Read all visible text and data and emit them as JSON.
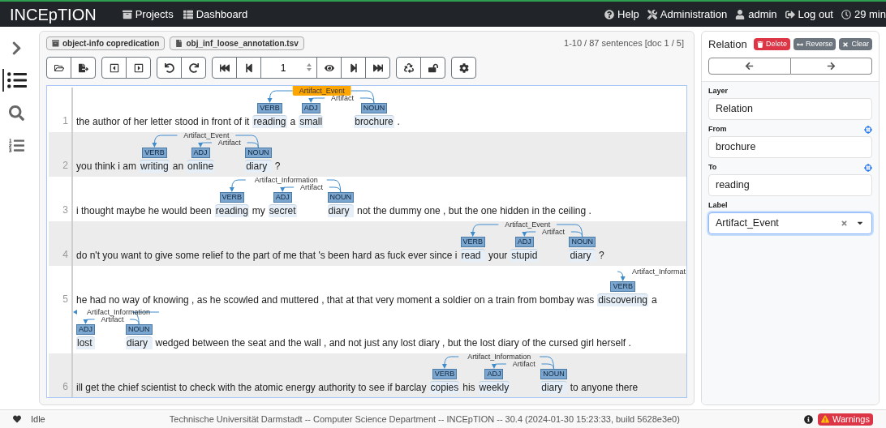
{
  "navbar": {
    "brand": "INCEpTION",
    "left": [
      "Projects",
      "Dashboard"
    ],
    "right": [
      "Help",
      "Administration",
      "admin",
      "Log out",
      "29 min"
    ]
  },
  "sidebar": [
    {
      "selected": false
    },
    {
      "selected": true
    },
    {
      "selected": false
    },
    {
      "selected": false
    }
  ],
  "breadcrumbs": [
    "object-info copredication",
    "obj_inf_loose_annotation.tsv"
  ],
  "sentence_info": "1-10 / 87 sentences [doc 1 / 5]",
  "page_field": {
    "value": "1"
  },
  "sentences": [
    {
      "number": "1",
      "lines": [
        [
          {
            "text": "the author of her letter stood in front of it"
          },
          {
            "text": "reading",
            "tag": "VERB",
            "incoming": {
              "label": "Artifact_Event",
              "selected": true
            }
          },
          {
            "text": "a"
          },
          {
            "text": "small",
            "tag": "ADJ",
            "incoming": {
              "label": "Artifact",
              "selected": false
            }
          },
          {
            "text": "brochure",
            "tag": "NOUN"
          },
          {
            "text": "."
          }
        ]
      ]
    },
    {
      "number": "2",
      "lines": [
        [
          {
            "text": "you think i am"
          },
          {
            "text": "writing",
            "tag": "VERB",
            "incoming": {
              "label": "Artifact_Event",
              "selected": false
            }
          },
          {
            "text": "an"
          },
          {
            "text": "online",
            "tag": "ADJ",
            "incoming": {
              "label": "Artifact",
              "selected": false
            }
          },
          {
            "text": "diary",
            "tag": "NOUN"
          },
          {
            "text": "?"
          }
        ]
      ]
    },
    {
      "number": "3",
      "lines": [
        [
          {
            "text": "i thought maybe he would been"
          },
          {
            "text": "reading",
            "tag": "VERB",
            "incoming": {
              "label": "Artifact_Information",
              "selected": false
            }
          },
          {
            "text": "my"
          },
          {
            "text": "secret",
            "tag": "ADJ",
            "incoming": {
              "label": "Artifact",
              "selected": false
            }
          },
          {
            "text": "diary",
            "tag": "NOUN"
          },
          {
            "text": "not the dummy one , but the one hidden in the ceiling ."
          }
        ]
      ]
    },
    {
      "number": "4",
      "lines": [
        [
          {
            "text": "do n't you want to give some relief to the part of me that 's been hard as fuck ever since i"
          },
          {
            "text": "read",
            "tag": "VERB",
            "incoming": {
              "label": "Artifact_Event",
              "selected": false
            }
          },
          {
            "text": "your"
          },
          {
            "text": "stupid",
            "tag": "ADJ",
            "incoming": {
              "label": "Artifact",
              "selected": false
            }
          },
          {
            "text": "diary",
            "tag": "NOUN"
          },
          {
            "text": "?"
          }
        ]
      ]
    },
    {
      "number": "5",
      "lines": [
        [
          {
            "text": "he had no way of knowing , as he scowled and muttered , that at that very moment a soldier on a train from bombay was"
          },
          {
            "text": "discovering",
            "tag": "VERB",
            "incoming": {
              "label": "Artifact_Information",
              "continued_label": "Artifact_Informat",
              "selected": false
            }
          },
          {
            "text": "a"
          }
        ],
        [
          {
            "text": "lost",
            "tag": "ADJ",
            "incoming": {
              "label": "Artifact",
              "selected": false
            }
          },
          {
            "text": "diary",
            "tag": "NOUN"
          },
          {
            "text": "wedged between the seat and the wall , and not just any lost diary , but the lost diary of the cursed girl herself ."
          }
        ]
      ]
    },
    {
      "number": "6",
      "lines": [
        [
          {
            "text": "ill get the chief scientist to check with the atomic energy authority to see if barclay"
          },
          {
            "text": "copies",
            "tag": "VERB",
            "incoming": {
              "label": "Artifact_Information",
              "selected": false
            }
          },
          {
            "text": "his"
          },
          {
            "text": "weekly",
            "tag": "ADJ",
            "incoming": {
              "label": "Artifact",
              "selected": false
            }
          },
          {
            "text": "diary",
            "tag": "NOUN"
          },
          {
            "text": "to anyone there"
          }
        ]
      ]
    }
  ],
  "detail": {
    "title": "Relation",
    "buttons": [
      "Delete",
      "Reverse",
      "Clear"
    ],
    "fields": [
      {
        "label": "Layer",
        "value": "Relation",
        "kind": "text"
      },
      {
        "label": "From",
        "value": "brochure",
        "kind": "target"
      },
      {
        "label": "To",
        "value": "reading",
        "kind": "target"
      },
      {
        "label": "Label",
        "value": "Artifact_Event",
        "kind": "combo"
      }
    ]
  },
  "status": {
    "state": "Idle",
    "footer": "Technische Universität Darmstadt -- Computer Science Department -- INCEpTION -- 30.4 (2024-01-30 15:23:33, build 5628e3e0)",
    "warnings": "Warnings"
  }
}
